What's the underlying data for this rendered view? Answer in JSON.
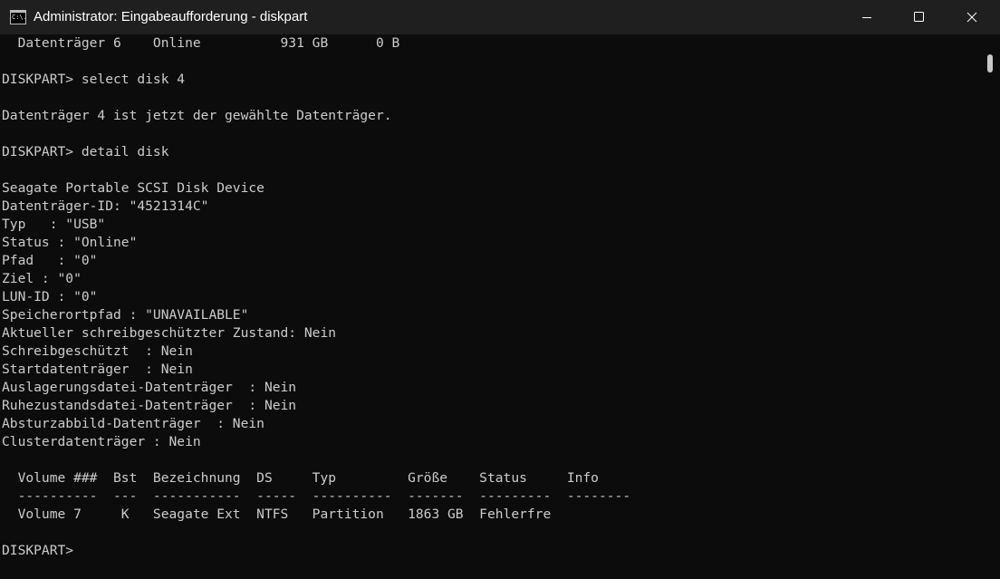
{
  "window": {
    "title": "Administrator: Eingabeaufforderung - diskpart",
    "icon_text": "C:\\.",
    "icon": "cmd-icon",
    "controls": [
      "minimize-icon",
      "maximize-icon",
      "close-icon"
    ]
  },
  "console": {
    "lines": [
      "  Datenträger 6    Online          931 GB      0 B",
      "",
      "DISKPART> select disk 4",
      "",
      "Datenträger 4 ist jetzt der gewählte Datenträger.",
      "",
      "DISKPART> detail disk",
      "",
      "Seagate Portable SCSI Disk Device",
      "Datenträger-ID: \"4521314C\"",
      "Typ   : \"USB\"",
      "Status : \"Online\"",
      "Pfad   : \"0\"",
      "Ziel : \"0\"",
      "LUN-ID : \"0\"",
      "Speicherortpfad : \"UNAVAILABLE\"",
      "Aktueller schreibgeschützter Zustand: Nein",
      "Schreibgeschützt  : Nein",
      "Startdatenträger  : Nein",
      "Auslagerungsdatei-Datenträger  : Nein",
      "Ruhezustandsdatei-Datenträger  : Nein",
      "Absturzabbild-Datenträger  : Nein",
      "Clusterdatenträger : Nein",
      "",
      "  Volume ###  Bst  Bezeichnung  DS     Typ         Größe    Status     Info",
      "  ----------  ---  -----------  -----  ----------  -------  ---------  --------",
      "  Volume 7     K   Seagate Ext  NTFS   Partition   1863 GB  Fehlerfre",
      "",
      "DISKPART>"
    ]
  },
  "colors": {
    "titlebar": "#1f1f1f",
    "background": "#0c0c0c",
    "text": "#cccccc"
  }
}
